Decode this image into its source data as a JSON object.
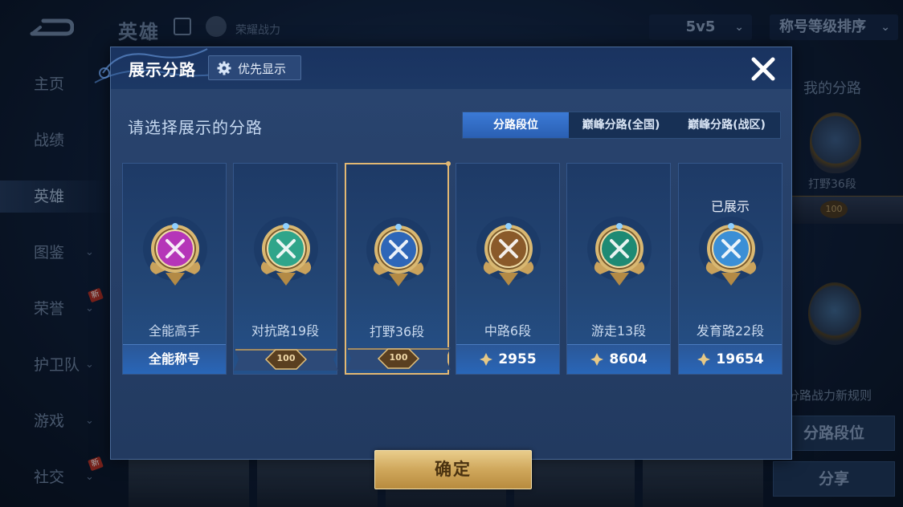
{
  "background": {
    "title": "英雄",
    "rank_text": "荣耀战力",
    "mode_dropdown": "5v5",
    "sort_dropdown": "称号等级排序",
    "nav": [
      {
        "label": "主页",
        "chevron": false,
        "new": false,
        "active": false
      },
      {
        "label": "战绩",
        "chevron": false,
        "new": false,
        "active": false
      },
      {
        "label": "英雄",
        "chevron": false,
        "new": false,
        "active": true
      },
      {
        "label": "图鉴",
        "chevron": true,
        "new": false,
        "active": false
      },
      {
        "label": "荣誉",
        "chevron": true,
        "new": true,
        "active": false
      },
      {
        "label": "护卫队",
        "chevron": true,
        "new": false,
        "active": false
      },
      {
        "label": "游戏",
        "chevron": true,
        "new": false,
        "active": false
      },
      {
        "label": "社交",
        "chevron": true,
        "new": true,
        "active": false
      }
    ],
    "new_badge": "新",
    "right_panel": {
      "title": "我的分路",
      "badge_label": "打野36段",
      "ribbon_value": "100",
      "rule_text": "分路战力新规则",
      "btn_lane_rank": "分路段位",
      "btn_share": "分享"
    }
  },
  "modal": {
    "title": "展示分路",
    "priority_label": "优先显示",
    "subtitle": "请选择展示的分路",
    "tabs": [
      "分路段位",
      "巅峰分路(全国)",
      "巅峰分路(战区)"
    ],
    "active_tab": 0,
    "shown_label": "已展示",
    "cards": [
      {
        "name": "全能高手",
        "footer_type": "text",
        "footer_text": "全能称号",
        "badge_color": "#b535b8",
        "selected": false,
        "shown": false
      },
      {
        "name": "对抗路19段",
        "footer_type": "ribbon",
        "footer_text": "100",
        "badge_color": "#2fa58a",
        "selected": false,
        "shown": false
      },
      {
        "name": "打野36段",
        "footer_type": "ribbon",
        "footer_text": "100",
        "badge_color": "#2e66b8",
        "selected": true,
        "shown": false
      },
      {
        "name": "中路6段",
        "footer_type": "score",
        "footer_text": "2955",
        "badge_color": "#8a5a2a",
        "selected": false,
        "shown": false
      },
      {
        "name": "游走13段",
        "footer_type": "score",
        "footer_text": "8604",
        "badge_color": "#1e8a74",
        "selected": false,
        "shown": false
      },
      {
        "name": "发育路22段",
        "footer_type": "score",
        "footer_text": "19654",
        "badge_color": "#3b8fd6",
        "selected": false,
        "shown": true
      }
    ],
    "confirm_label": "确定"
  },
  "colors": {
    "gold": "#e2b873",
    "active_tab": "#3b7ad6",
    "modal_bg": "#223a60"
  }
}
